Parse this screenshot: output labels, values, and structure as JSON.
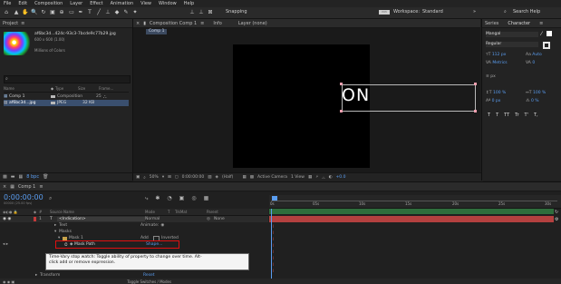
{
  "menu": [
    "File",
    "Edit",
    "Composition",
    "Layer",
    "Effect",
    "Animation",
    "View",
    "Window",
    "Help"
  ],
  "toolbar": {
    "snapping_label": "Snapping",
    "workspace_label": "Workspace:",
    "workspace_value": "Standard",
    "search_help": "Search Help"
  },
  "project": {
    "tab_label": "Project",
    "item_name": "af6bc3d...424c-93c3-7bcde9c77b29.jpg",
    "item_dims": "600 x 600 (1.00)",
    "item_colors": "Millions of Colors",
    "columns": [
      "Name",
      "Type",
      "Size",
      "Frame..."
    ],
    "rows": [
      {
        "name": "Comp 1",
        "type": "Composition",
        "size": "",
        "frame": "25"
      },
      {
        "name": "af6bc3d...jpg",
        "type": "JPEG",
        "size": "32 KB",
        "frame": ""
      }
    ],
    "footer_bpc": "8 bpc"
  },
  "composition_panel": {
    "tab_label": "Composition Comp 1",
    "info_tab": "Info",
    "layer_tab": "Layer (none)",
    "comp_tab": "Comp 1",
    "canvas_text": "ON",
    "zoom": "50%",
    "timecode": "0:00:00:00",
    "resolution": "(Half)",
    "camera": "Active Camera",
    "view": "1 View",
    "offset": "+0.0"
  },
  "character_panel": {
    "tabs": [
      "Series",
      "Character"
    ],
    "font": "Mangal",
    "style": "Regular",
    "size": "112 px",
    "leading": "Auto",
    "kerning": "Metrics",
    "tracking": "0",
    "stroke": "px",
    "vert_scale": "100 %",
    "horiz_scale": "100 %",
    "baseline": "0 px",
    "tsume": "0 %",
    "styles": [
      "T",
      "T",
      "TT",
      "Tr",
      "T'",
      "T,"
    ]
  },
  "timeline": {
    "tab_label": "Comp 1",
    "timecode": "0:00:00:00",
    "timecode_sub": "00000 (25.00 fps)",
    "columns": [
      "#",
      "Source Name",
      "Mode",
      "T",
      "TrkMat",
      "Parent"
    ],
    "layer_num": "1",
    "layer_name": "<Indication>",
    "layer_mode": "Normal",
    "layer_parent": "None",
    "props": [
      "Text",
      "Masks",
      "Mask 1",
      "Mask Path",
      "Transform"
    ],
    "mode_add": "Add",
    "inverted": "Inverted",
    "animate": "Animate:",
    "shape_value": "Shape...",
    "reset": "Reset",
    "ruler_ticks": [
      "0s",
      "05s",
      "10s",
      "15s",
      "20s",
      "25s",
      "30s"
    ],
    "footer": "Toggle Switches / Modes"
  },
  "tooltip": {
    "line1": "Time-Vary stop watch: Toggle ability of property to change over time. Alt-",
    "line2": "click add or remove expression."
  },
  "colors": {
    "accent_blue": "#5a9df0",
    "highlight_red": "#e01010",
    "track_red": "#b4403f",
    "track_green": "#2f6d3c"
  }
}
